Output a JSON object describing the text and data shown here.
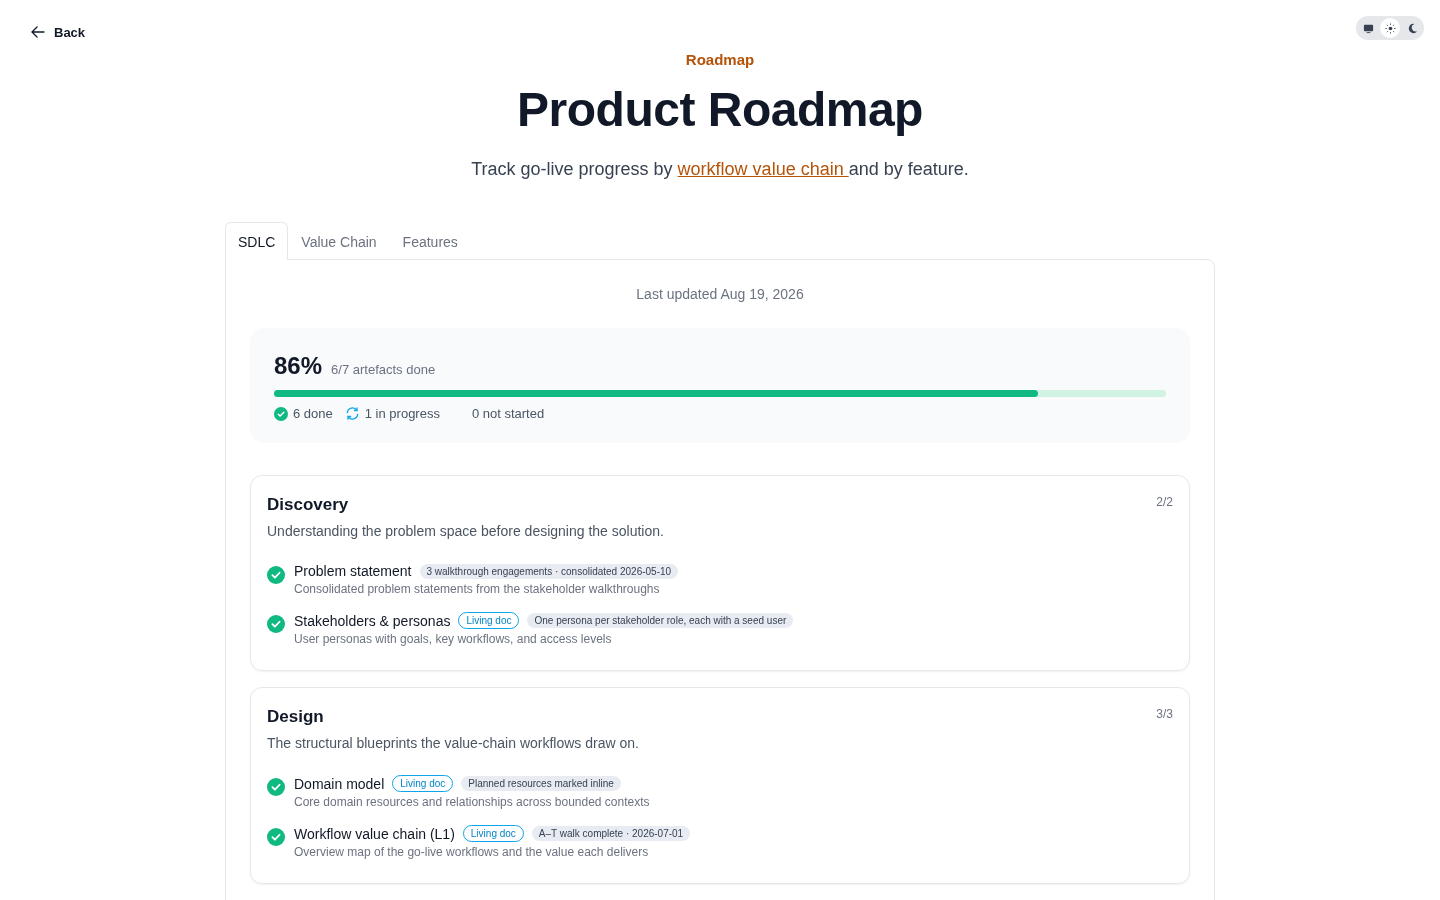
{
  "back": {
    "label": "Back"
  },
  "theme_toggle": [
    {
      "kind": "monitor",
      "selected": false
    },
    {
      "kind": "sun",
      "selected": true
    },
    {
      "kind": "moon",
      "selected": false
    }
  ],
  "header": {
    "eyebrow": "Roadmap",
    "title": "Product Roadmap",
    "subtitle_before": "Track go-live progress by ",
    "subtitle_link": "workflow value chain ",
    "subtitle_after": "and by feature."
  },
  "tabs": [
    {
      "label": "SDLC",
      "selected": true
    },
    {
      "label": "Value Chain",
      "selected": false
    },
    {
      "label": "Features",
      "selected": false
    }
  ],
  "last_updated": "Last updated Aug 19, 2026",
  "summary": {
    "percent": "86%",
    "caption": "6/7 artefacts done",
    "level": 0.857,
    "stats": [
      {
        "kind": "done",
        "label": "6 done"
      },
      {
        "kind": "progress",
        "label": "1 in progress"
      },
      {
        "kind": "not_started",
        "label": "0 not started"
      }
    ]
  },
  "phases": [
    {
      "title": "Discovery",
      "count": "2/2",
      "description": "Understanding the problem space before designing the solution.",
      "items": [
        {
          "done": true,
          "title": "Problem statement",
          "badges": [
            {
              "kind": "note",
              "label": "3 walkthrough engagements · consolidated 2026-05-10"
            }
          ],
          "description": "Consolidated problem statements from the stakeholder walkthroughs"
        },
        {
          "done": true,
          "title": "Stakeholders & personas",
          "badges": [
            {
              "kind": "living",
              "label": "Living doc"
            },
            {
              "kind": "note",
              "label": "One persona per stakeholder role, each with a seed user"
            }
          ],
          "description": "User personas with goals, key workflows, and access levels"
        }
      ]
    },
    {
      "title": "Design",
      "count": "3/3",
      "description": "The structural blueprints the value-chain workflows draw on.",
      "items": [
        {
          "done": true,
          "title": "Domain model",
          "badges": [
            {
              "kind": "living",
              "label": "Living doc"
            },
            {
              "kind": "note",
              "label": "Planned resources marked inline"
            }
          ],
          "description": "Core domain resources and relationships across bounded contexts"
        },
        {
          "done": true,
          "title": "Workflow value chain (L1)",
          "badges": [
            {
              "kind": "living",
              "label": "Living doc"
            },
            {
              "kind": "note",
              "label": "A–T walk complete · 2026-07-01"
            }
          ],
          "description": "Overview map of the go-live workflows and the value each delivers"
        }
      ]
    }
  ]
}
